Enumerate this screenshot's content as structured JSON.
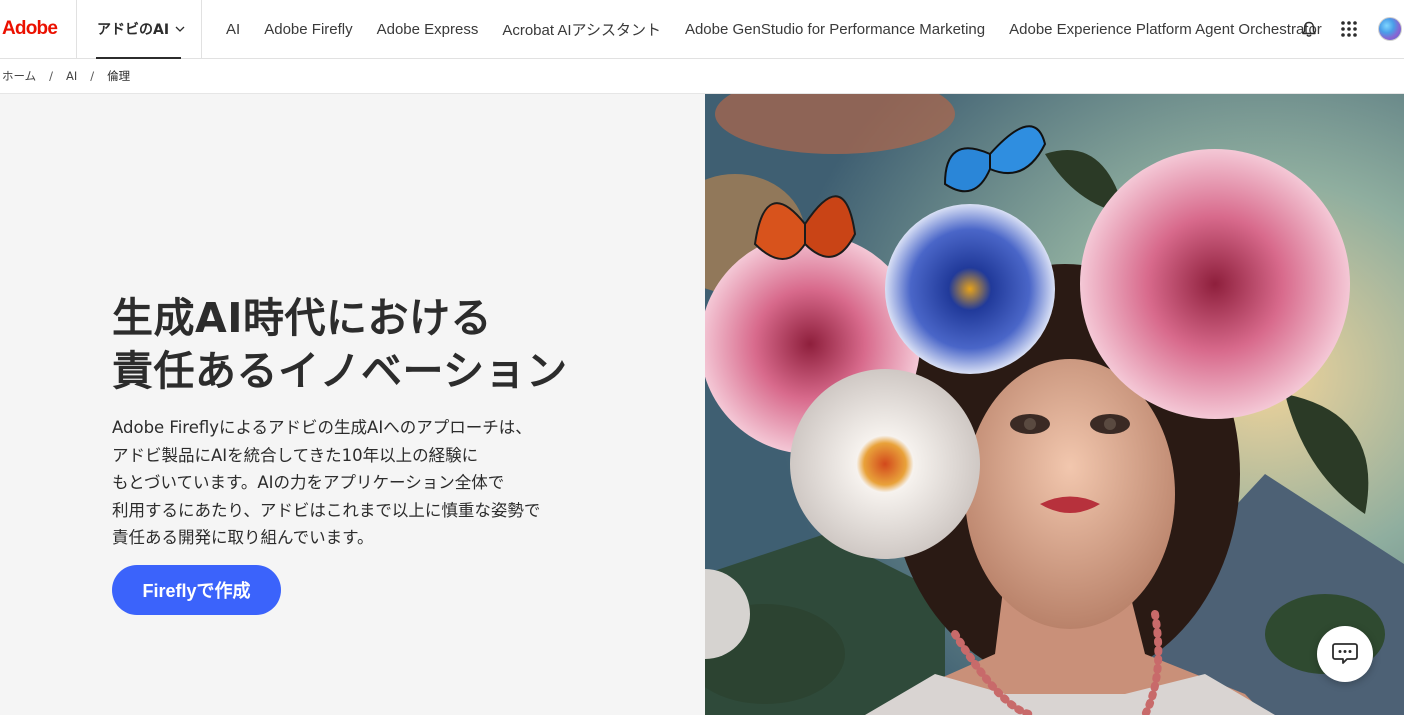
{
  "brand": {
    "logo_text": "Adobe",
    "color": "#eb1000"
  },
  "nav": {
    "main_label": "アドビのAI",
    "links": [
      "AI",
      "Adobe Firefly",
      "Adobe Express",
      "Acrobat AIアシスタント",
      "Adobe GenStudio for Performance Marketing",
      "Adobe Experience Platform Agent Orchestrator"
    ],
    "icons": [
      "bell-icon",
      "app-grid-icon",
      "avatar"
    ]
  },
  "breadcrumb": {
    "items": [
      "ホーム",
      "AI",
      "倫理"
    ],
    "separator": "/"
  },
  "hero": {
    "headline_lines": [
      "生成AI時代における",
      "責任あるイノベーション"
    ],
    "body_lines": [
      "Adobe Fireflyによるアドビの生成AIへのアプローチは、",
      "アドビ製品にAIを統合してきた10年以上の経験に",
      "もとづいています。AIの力をアプリケーション全体で",
      "利用するにあたり、アドビはこれまで以上に慎重な姿勢で",
      "責任ある開発に取り組んでいます。"
    ],
    "cta_label": "Fireflyで作成",
    "cta_color": "#3b63fb"
  },
  "chat": {
    "icon": "chat-icon"
  }
}
